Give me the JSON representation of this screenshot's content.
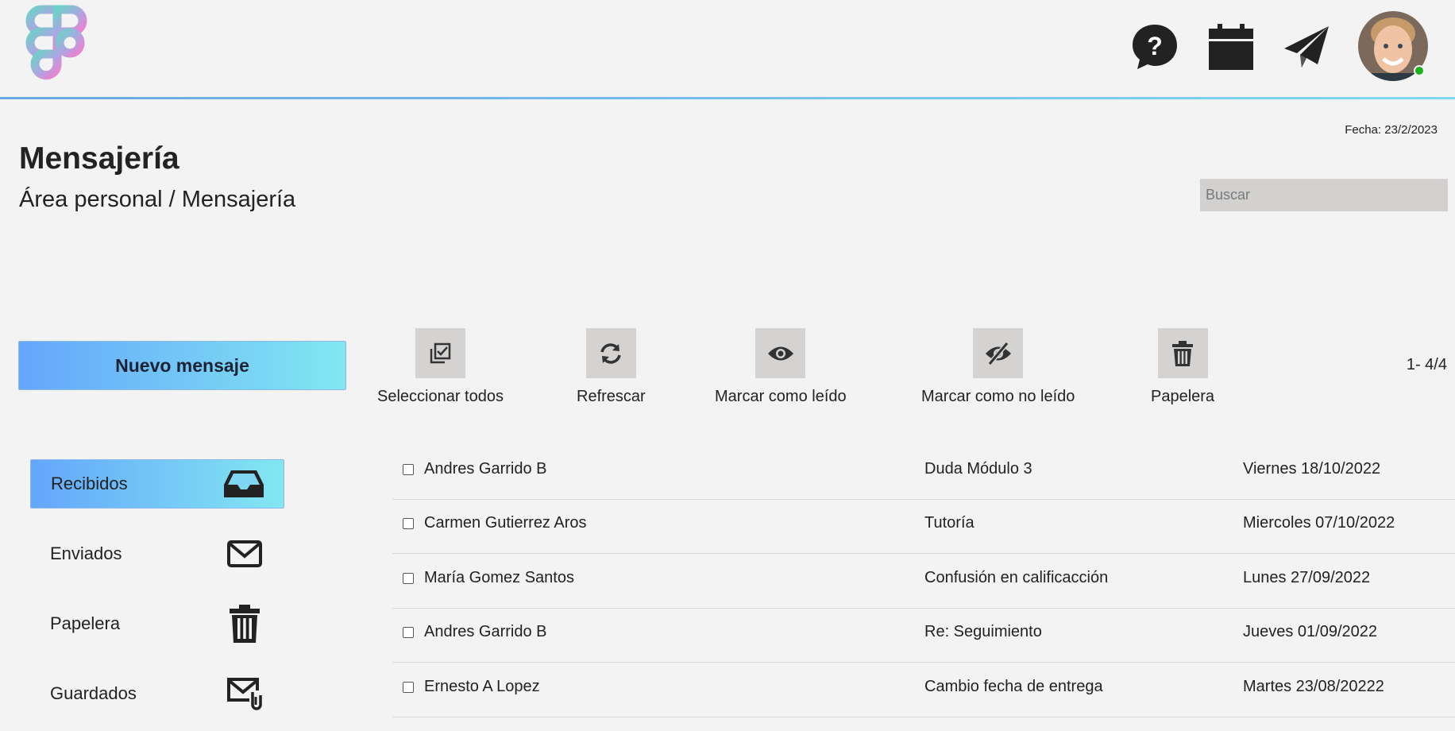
{
  "header": {
    "logo_icon": "figma-logo",
    "icons": [
      "help-chat-icon",
      "calendar-icon",
      "paper-plane-icon"
    ],
    "avatar_status_color": "#1cb01c"
  },
  "page": {
    "date": "Fecha: 23/2/2023",
    "title": "Mensajería",
    "breadcrumb": "Área personal / Mensajería",
    "search_placeholder": "Buscar"
  },
  "actions": {
    "new_message": "Nuevo mensaje",
    "select_all": "Seleccionar todos",
    "refresh": "Refrescar",
    "mark_read": "Marcar como leído",
    "mark_unread": "Marcar como no leído",
    "trash": "Papelera",
    "pagination": "1- 4/4"
  },
  "folders": [
    {
      "label": "Recibidos",
      "icon": "inbox-icon",
      "active": true
    },
    {
      "label": "Enviados",
      "icon": "envelope-icon",
      "active": false
    },
    {
      "label": "Papelera",
      "icon": "trash-icon",
      "active": false
    },
    {
      "label": "Guardados",
      "icon": "envelope-attachment-icon",
      "active": false
    }
  ],
  "messages": [
    {
      "sender": "Andres Garrido B",
      "subject": "Duda Módulo 3",
      "date": "Viernes 18/10/2022"
    },
    {
      "sender": "Carmen Gutierrez Aros",
      "subject": "Tutoría",
      "date": "Miercoles 07/10/2022"
    },
    {
      "sender": "María Gomez Santos",
      "subject": "Confusión en calificacción",
      "date": "Lunes 27/09/2022"
    },
    {
      "sender": "Andres Garrido B",
      "subject": "Re: Seguimiento",
      "date": "Jueves 01/09/2022"
    },
    {
      "sender": "Ernesto A Lopez",
      "subject": "Cambio fecha de entrega",
      "date": "Martes 23/08/20222"
    }
  ],
  "colors": {
    "accent_start": "#64a6fb",
    "accent_end": "#82e7f1",
    "background": "#f3f3f3"
  }
}
